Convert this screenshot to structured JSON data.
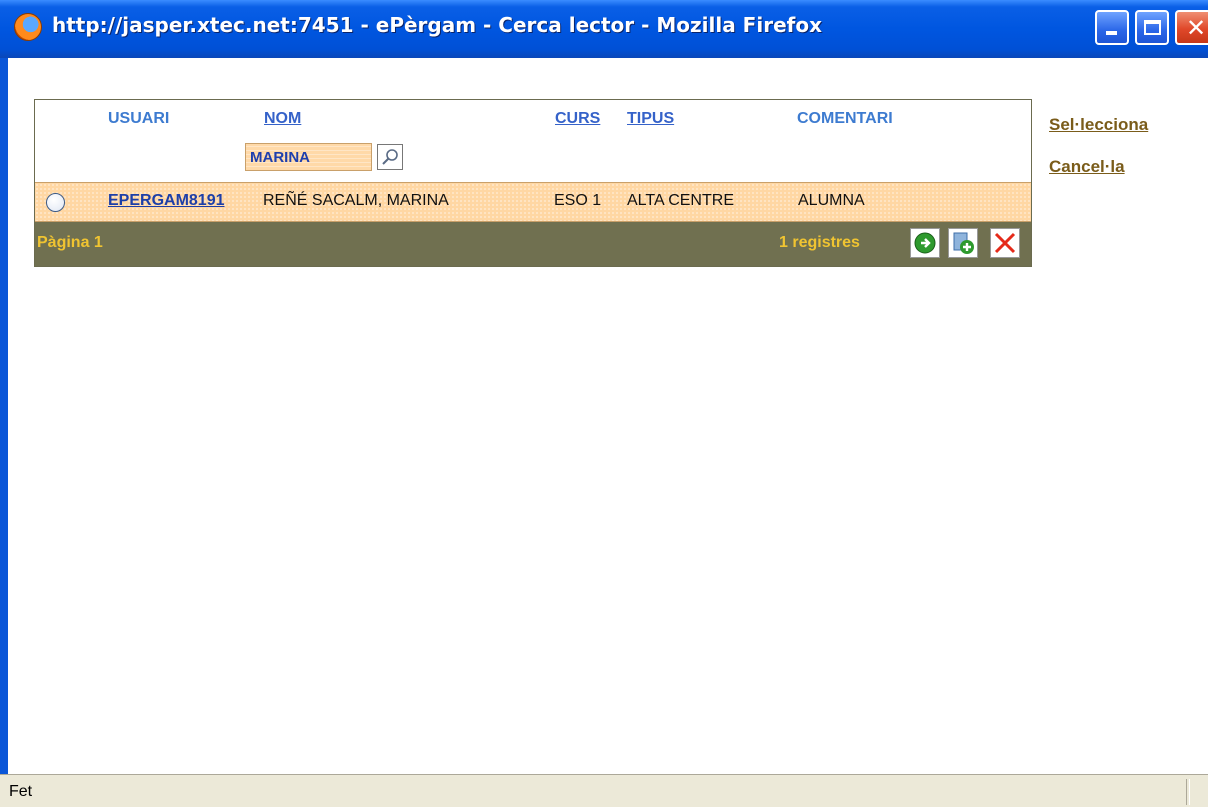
{
  "window": {
    "title": "http://jasper.xtec.net:7451 - ePèrgam - Cerca lector - Mozilla Firefox"
  },
  "grid": {
    "columns": {
      "usuari": "USUARI",
      "nom": "NOM",
      "curs": "CURS",
      "tipus": "TIPUS",
      "comentari": "COMENTARI"
    },
    "search": {
      "value": "MARINA"
    },
    "rows": [
      {
        "usuari": "EPERGAM8191",
        "nom": "REÑÉ SACALM, MARINA",
        "curs": "ESO 1",
        "tipus": "ALTA CENTRE",
        "comentari": "ALUMNA",
        "selected": false
      }
    ],
    "pager": {
      "page_label": "Pàgina 1",
      "count_label": "1 registres"
    }
  },
  "actions": {
    "select": "Sel·lecciona",
    "cancel": "Cancel·la"
  },
  "status": {
    "text": "Fet"
  },
  "colors": {
    "row_bg": "#ffd7a3",
    "pager_bg": "#707050",
    "pager_text": "#f0c431",
    "link": "#7a5c1a"
  }
}
